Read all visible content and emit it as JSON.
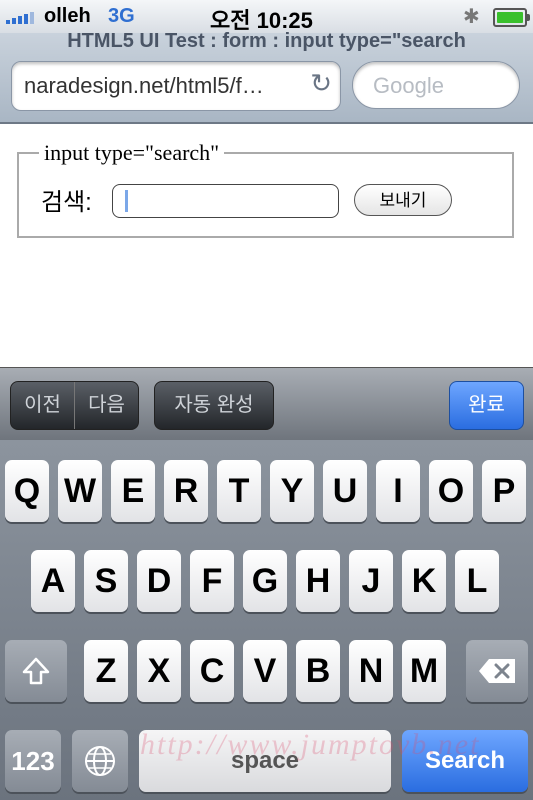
{
  "status": {
    "carrier": "olleh",
    "network": "3G",
    "time": "오전 10:25"
  },
  "browser": {
    "title": "HTML5 UI Test : form : input type=\"search",
    "url": "naradesign.net/html5/f…",
    "search_placeholder": "Google"
  },
  "form": {
    "legend": "input type=\"search\"",
    "label": "검색:",
    "input_value": "",
    "submit_label": "보내기"
  },
  "form_toolbar": {
    "prev": "이전",
    "next": "다음",
    "autofill": "자동 완성",
    "done": "완료"
  },
  "keyboard": {
    "row1": [
      "Q",
      "W",
      "E",
      "R",
      "T",
      "Y",
      "U",
      "I",
      "O",
      "P"
    ],
    "row2": [
      "A",
      "S",
      "D",
      "F",
      "G",
      "H",
      "J",
      "K",
      "L"
    ],
    "row3": [
      "Z",
      "X",
      "C",
      "V",
      "B",
      "N",
      "M"
    ],
    "numbers": "123",
    "space": "space",
    "search": "Search"
  },
  "watermark": "http://www.jumptovb.net",
  "icons": {
    "shift": "shift-icon",
    "delete": "backspace-icon",
    "globe": "globe-icon",
    "reload": "reload-icon",
    "bluetooth": "bluetooth-icon"
  },
  "colors": {
    "accent_blue": "#2a6de0",
    "battery_green": "#39c02c"
  }
}
